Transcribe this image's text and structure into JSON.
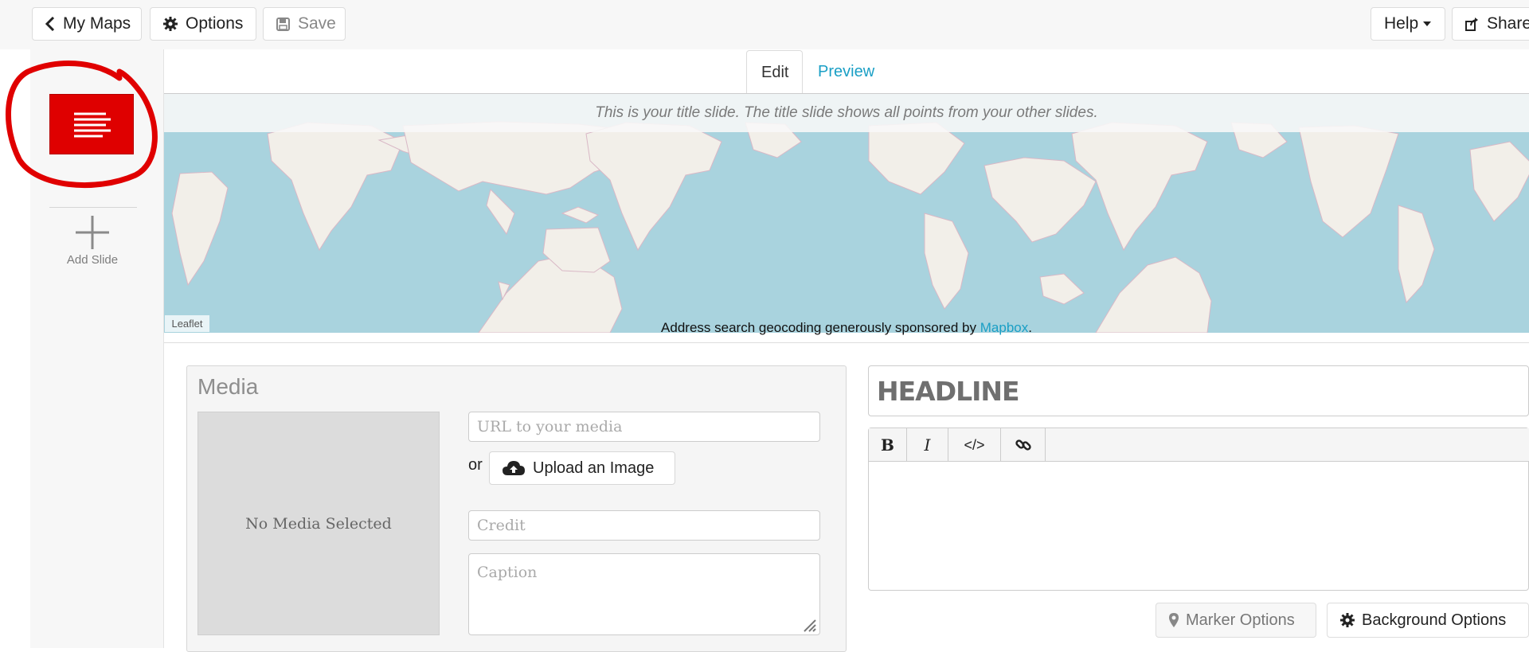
{
  "toolbar": {
    "my_maps_label": "My Maps",
    "options_label": "Options",
    "save_label": "Save",
    "help_label": "Help",
    "share_label": "Share"
  },
  "sidebar": {
    "add_slide_label": "Add Slide"
  },
  "tabs": [
    {
      "label": "Edit",
      "active": true
    },
    {
      "label": "Preview",
      "active": false
    }
  ],
  "map": {
    "title_slide_note": "This is your title slide. The title slide shows all points from your other slides.",
    "attribution": "Leaflet",
    "sponsor_text": "Address search geocoding generously sponsored by",
    "sponsor_link": "Mapbox",
    "sponsor_suffix": "."
  },
  "media": {
    "heading": "Media",
    "preview_text": "No Media Selected",
    "url_placeholder": "URL to your media",
    "or_text": "or",
    "upload_label": "Upload an Image",
    "credit_placeholder": "Credit",
    "caption_placeholder": "Caption"
  },
  "text": {
    "headline_placeholder": "HEADLINE",
    "editor_buttons": [
      "B",
      "I",
      "</>"
    ],
    "marker_options_label": "Marker Options",
    "background_options_label": "Background Options"
  },
  "colors": {
    "accent_link": "#1a9fc5",
    "slide_thumb": "#df0000",
    "annotation_circle": "#e00000",
    "map_water": "#a9d3de",
    "map_land": "#f2efe9"
  }
}
